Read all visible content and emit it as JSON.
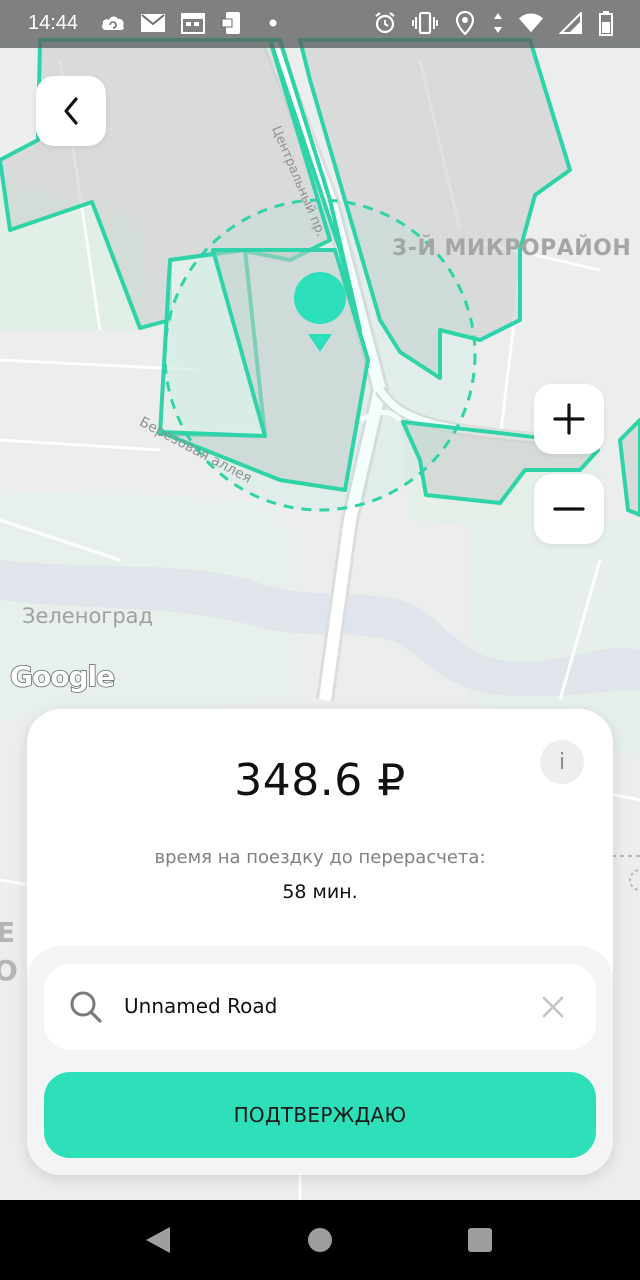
{
  "status_bar": {
    "time": "14:44",
    "left_icons": [
      "cloud-sync-icon",
      "mail-icon",
      "calendar-icon",
      "sim-app-icon",
      "dot-icon"
    ],
    "right_icons": [
      "alarm-icon",
      "vibrate-icon",
      "location-icon",
      "data-arrows-icon",
      "wifi-icon",
      "signal-icon",
      "battery-icon"
    ]
  },
  "map": {
    "district_label": "3-Й МИКРОРАЙОН",
    "city_label": "Зеленоград",
    "street_label_1": "Центральный пр.",
    "street_label_2": "Березовая аллея",
    "edge_label_1": "Е",
    "edge_label_2": "О",
    "attribution": "Google",
    "zone_color": "#2ed3a7",
    "marker_color": "#2ee0b9"
  },
  "controls": {
    "back_icon": "chevron-left-icon",
    "zoom_in_icon": "plus-icon",
    "zoom_out_icon": "minus-icon"
  },
  "card": {
    "price": "348.6 ₽",
    "info_label": "i",
    "recalc_label": "время на поездку до перерасчета:",
    "recalc_value": "58 мин.",
    "search": {
      "value": "Unnamed Road",
      "icon": "search-icon",
      "clear_icon": "close-icon"
    },
    "confirm_label": "ПОДТВЕРЖДАЮ",
    "accent": "#2ee0b9"
  },
  "nav_bar": {
    "icons": [
      "nav-back-icon",
      "nav-home-icon",
      "nav-recent-icon"
    ]
  }
}
